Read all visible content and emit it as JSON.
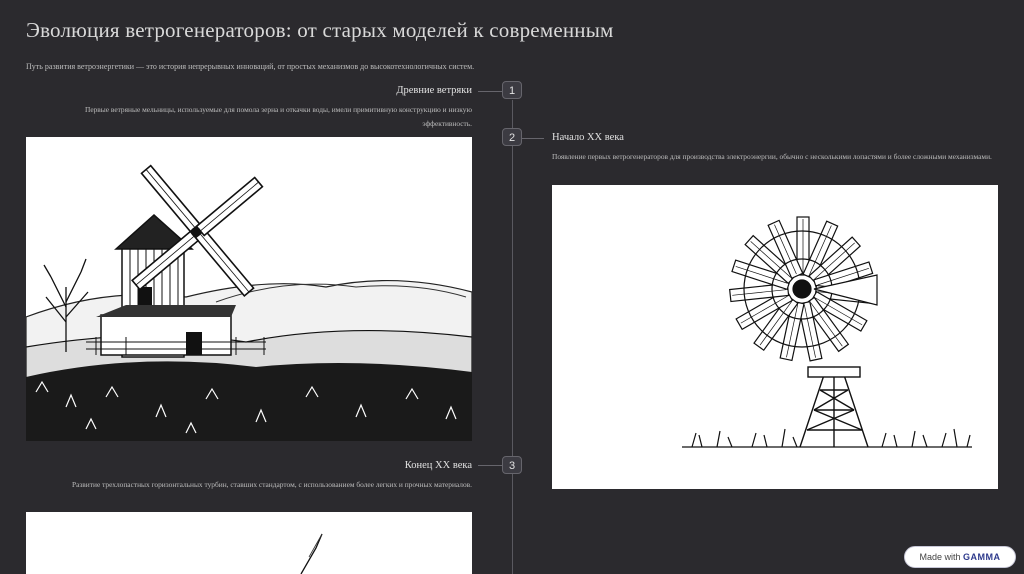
{
  "page": {
    "title": "Эволюция ветрогенераторов: от старых моделей к современным",
    "subtitle": "Путь развития ветроэнергетики — это история непрерывных инноваций, от простых механизмов до высокотехнологичных систем."
  },
  "timeline": [
    {
      "number": "1",
      "title": "Древние ветряки",
      "description": "Первые ветряные мельницы, используемые для помола зерна и откачки воды, имели примитивную конструкцию и низкую эффективность."
    },
    {
      "number": "2",
      "title": "Начало XX века",
      "description": "Появление первых ветрогенераторов для производства электроэнергии, обычно с несколькими лопастями и более сложными механизмами."
    },
    {
      "number": "3",
      "title": "Конец XX века",
      "description": "Развитие трехлопастных горизонтальных турбин, ставших стандартом, с использованием более легких и прочных материалов."
    }
  ],
  "badge": {
    "prefix": "Made with",
    "brand": "GAMMA"
  }
}
